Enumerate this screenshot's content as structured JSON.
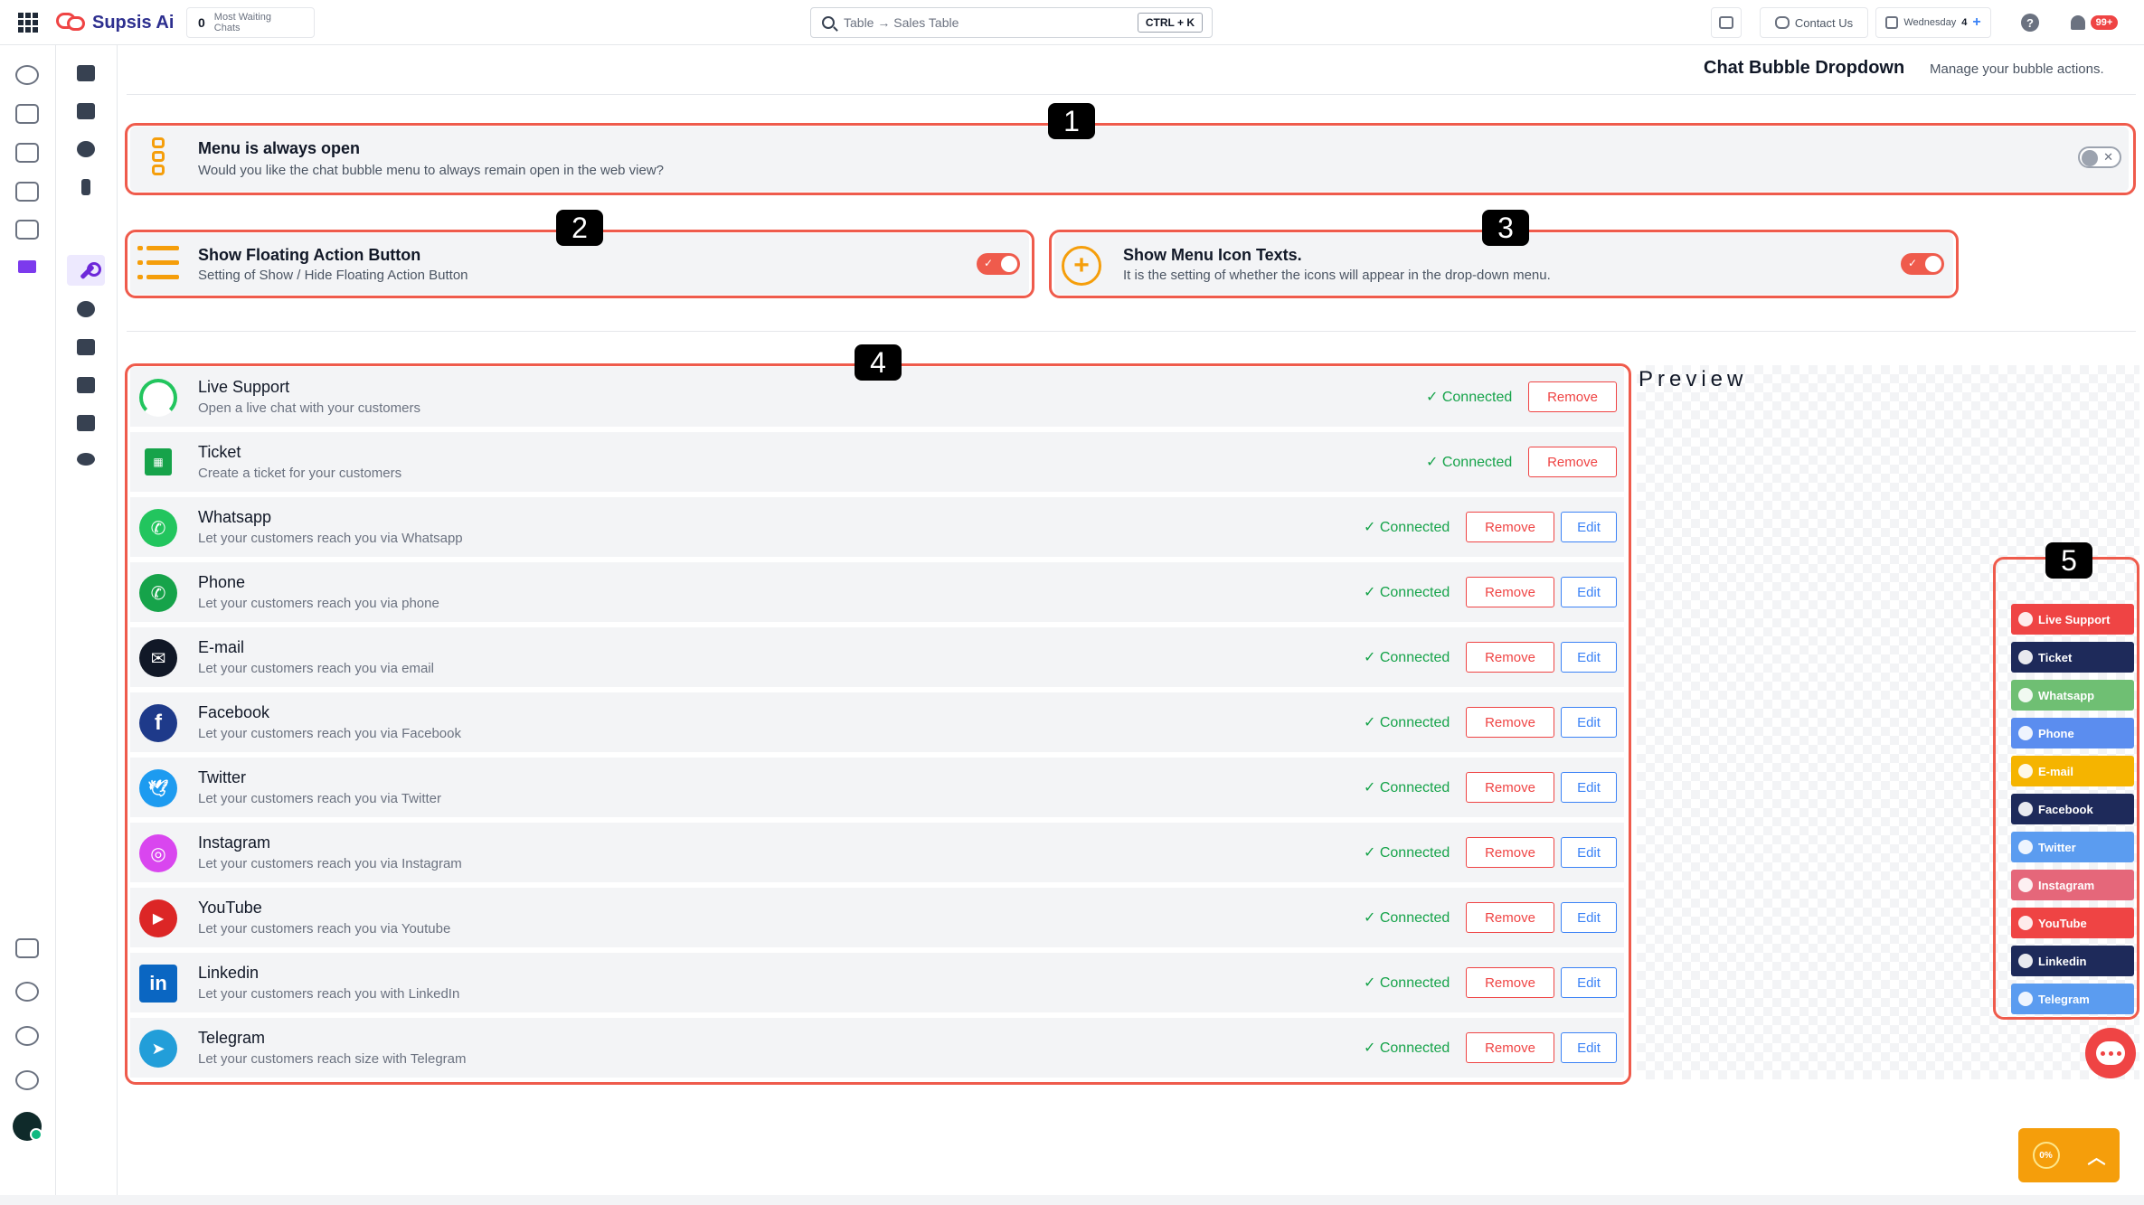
{
  "topbar": {
    "brand": "Supsis Ai",
    "waiting_count": "0",
    "waiting_label": "Most Waiting Chats",
    "search_placeholder": "Table → Sales Table",
    "search_shortcut": "CTRL + K",
    "contact_label": "Contact Us",
    "day_label": "Wednesday",
    "day_count": "4",
    "notifications_badge": "99+"
  },
  "header": {
    "title": "Chat Bubble Dropdown",
    "subtitle": "Manage your bubble actions."
  },
  "settings": {
    "always_open": {
      "badge": "1",
      "title": "Menu is always open",
      "description": "Would you like the chat bubble menu to always remain open in the web view?",
      "enabled": false
    },
    "floating_button": {
      "badge": "2",
      "title": "Show Floating Action Button",
      "description": "Setting of Show / Hide Floating Action Button",
      "enabled": true
    },
    "icon_texts": {
      "badge": "3",
      "title": "Show Menu Icon Texts.",
      "description": "It is the setting of whether the icons will appear in the drop-down menu.",
      "enabled": true
    }
  },
  "channels_badge": "4",
  "channels": [
    {
      "title": "Live Support",
      "description": "Open a live chat with your customers",
      "status": "✓ Connected",
      "remove": "Remove",
      "color": "#22c55e"
    },
    {
      "title": "Ticket",
      "description": "Create a ticket for your customers",
      "status": "✓ Connected",
      "remove": "Remove",
      "color": "#16a34a"
    },
    {
      "title": "Whatsapp",
      "description": "Let your customers reach you via Whatsapp",
      "status": "✓ Connected",
      "remove": "Remove",
      "edit": "Edit",
      "color": "#22c55e"
    },
    {
      "title": "Phone",
      "description": "Let your customers reach you via phone",
      "status": "✓ Connected",
      "remove": "Remove",
      "edit": "Edit",
      "color": "#16a34a"
    },
    {
      "title": "E-mail",
      "description": "Let your customers reach you via email",
      "status": "✓ Connected",
      "remove": "Remove",
      "edit": "Edit",
      "color": "#111827"
    },
    {
      "title": "Facebook",
      "description": "Let your customers reach you via Facebook",
      "status": "✓ Connected",
      "remove": "Remove",
      "edit": "Edit",
      "color": "#1e3a8a"
    },
    {
      "title": "Twitter",
      "description": "Let your customers reach you via Twitter",
      "status": "✓ Connected",
      "remove": "Remove",
      "edit": "Edit",
      "color": "#1d9bf0"
    },
    {
      "title": "Instagram",
      "description": "Let your customers reach you via Instagram",
      "status": "✓ Connected",
      "remove": "Remove",
      "edit": "Edit",
      "color": "#d946ef"
    },
    {
      "title": "YouTube",
      "description": "Let your customers reach you via Youtube",
      "status": "✓ Connected",
      "remove": "Remove",
      "edit": "Edit",
      "color": "#dc2626"
    },
    {
      "title": "Linkedin",
      "description": "Let your customers reach you with LinkedIn",
      "status": "✓ Connected",
      "remove": "Remove",
      "edit": "Edit",
      "color": "#0a66c2"
    },
    {
      "title": "Telegram",
      "description": "Let your customers reach size with Telegram",
      "status": "✓ Connected",
      "remove": "Remove",
      "edit": "Edit",
      "color": "#229ed9"
    }
  ],
  "preview": {
    "label": "Preview",
    "badge": "5",
    "items": [
      {
        "label": "Live Support",
        "color": "#ef4444"
      },
      {
        "label": "Ticket",
        "color": "#1e2a5a"
      },
      {
        "label": "Whatsapp",
        "color": "#6fbf73"
      },
      {
        "label": "Phone",
        "color": "#5b8def"
      },
      {
        "label": "E-mail",
        "color": "#f5b400"
      },
      {
        "label": "Facebook",
        "color": "#1e2a5a"
      },
      {
        "label": "Twitter",
        "color": "#5b9cf0"
      },
      {
        "label": "Instagram",
        "color": "#e5677a"
      },
      {
        "label": "YouTube",
        "color": "#ef4444"
      },
      {
        "label": "Linkedin",
        "color": "#1e2a5a"
      },
      {
        "label": "Telegram",
        "color": "#5b9cf0"
      }
    ]
  },
  "scroll_widget": {
    "percent": "0%"
  }
}
